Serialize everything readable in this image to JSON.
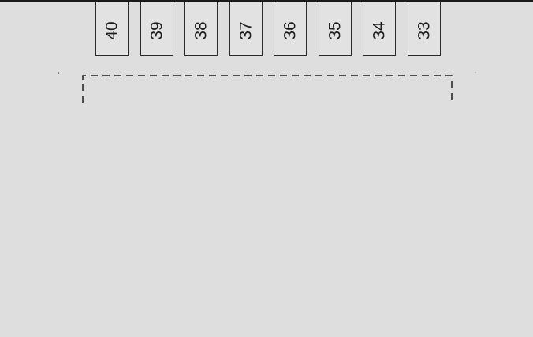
{
  "diagram": {
    "pins": [
      {
        "label": "40"
      },
      {
        "label": "39"
      },
      {
        "label": "38"
      },
      {
        "label": "37"
      },
      {
        "label": "36"
      },
      {
        "label": "35"
      },
      {
        "label": "34"
      },
      {
        "label": "33"
      }
    ]
  },
  "colors": {
    "background": "#dedede",
    "line": "#1e1e1e"
  }
}
